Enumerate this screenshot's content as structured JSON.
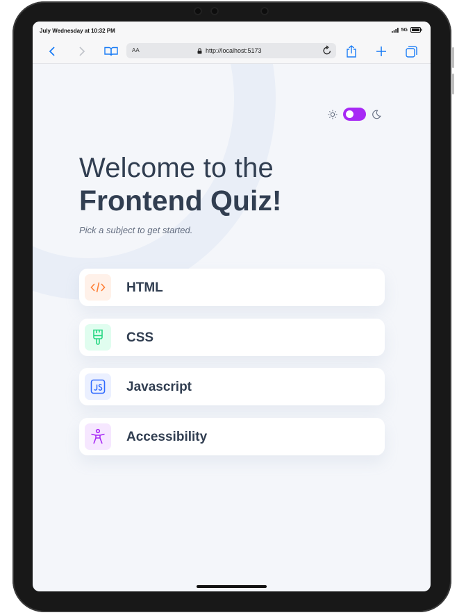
{
  "status_bar": {
    "time": "July Wednesday at 10:32 PM",
    "network": "5G"
  },
  "browser": {
    "text_size_label": "AA",
    "url": "http://localhost:5173"
  },
  "quiz": {
    "title_line1": "Welcome to the",
    "title_line2": "Frontend Quiz!",
    "subtitle": "Pick a subject to get started.",
    "subjects": [
      {
        "label": "HTML",
        "icon": "code-icon",
        "color": "#ff7e35",
        "bg": "#fff1e9"
      },
      {
        "label": "CSS",
        "icon": "paint-brush-icon",
        "color": "#26d782",
        "bg": "#e0fdef"
      },
      {
        "label": "Javascript",
        "icon": "javascript-icon",
        "color": "#306aff",
        "bg": "#ebf0ff"
      },
      {
        "label": "Accessibility",
        "icon": "accessibility-icon",
        "color": "#a729f5",
        "bg": "#f6e7ff"
      }
    ]
  },
  "theme": {
    "mode": "dark-toggle-on",
    "accent": "#a729f5"
  }
}
